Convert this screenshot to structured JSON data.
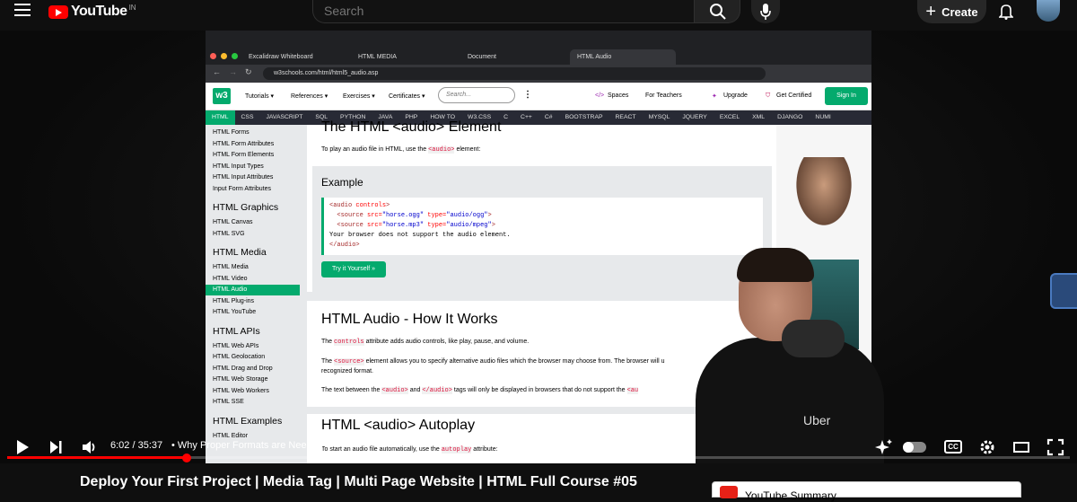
{
  "topbar": {
    "logo_text": "YouTube",
    "country_code": "IN",
    "search_placeholder": "Search",
    "create_label": "Create"
  },
  "browser": {
    "tabs": [
      "Excalidraw Whiteboard",
      "HTML MEDIA",
      "Document",
      "HTML Audio"
    ],
    "url": "w3schools.com/html/html5_audio.asp"
  },
  "w3": {
    "logo": "w3",
    "menus": [
      "Tutorials ▾",
      "References ▾",
      "Exercises ▾",
      "Certificates ▾"
    ],
    "search_placeholder": "Search...",
    "spaces": "Spaces",
    "teachers": "For Teachers",
    "upgrade": "Upgrade",
    "certified": "Get Certified",
    "signin": "Sign In",
    "topics": [
      "HTML",
      "CSS",
      "JAVASCRIPT",
      "SQL",
      "PYTHON",
      "JAVA",
      "PHP",
      "HOW TO",
      "W3.CSS",
      "C",
      "C++",
      "C#",
      "BOOTSTRAP",
      "REACT",
      "MYSQL",
      "JQUERY",
      "EXCEL",
      "XML",
      "DJANGO",
      "NUMI"
    ],
    "sidebar": {
      "group1": [
        "HTML Forms",
        "HTML Form Attributes",
        "HTML Form Elements",
        "HTML Input Types",
        "HTML Input Attributes",
        "Input Form Attributes"
      ],
      "h_graphics": "HTML Graphics",
      "group2": [
        "HTML Canvas",
        "HTML SVG"
      ],
      "h_media": "HTML Media",
      "group3": [
        "HTML Media",
        "HTML Video",
        "HTML Audio",
        "HTML Plug-ins",
        "HTML YouTube"
      ],
      "h_apis": "HTML APIs",
      "group4": [
        "HTML Web APIs",
        "HTML Geolocation",
        "HTML Drag and Drop",
        "HTML Web Storage",
        "HTML Web Workers",
        "HTML SSE"
      ],
      "h_examples": "HTML Examples",
      "group5": [
        "HTML Editor"
      ]
    },
    "page_heading": "The HTML <audio> Element",
    "intro_a": "To play an audio file in HTML, use the",
    "intro_kw": "<audio>",
    "intro_b": "element:",
    "example_title": "Example",
    "code": [
      "<audio controls>",
      "  <source src=\"horse.ogg\" type=\"audio/ogg\">",
      "  <source src=\"horse.mp3\" type=\"audio/mpeg\">",
      "Your browser does not support the audio element.",
      "</audio>"
    ],
    "tryit": "Try it Yourself »",
    "h_how": "HTML Audio - How It Works",
    "p1_a": "The",
    "p1_kw": "controls",
    "p1_b": "attribute adds audio controls, like play, pause, and volume.",
    "p2_a": "The",
    "p2_kw": "<source>",
    "p2_b": "element allows you to specify alternative audio files which the browser may choose from. The browser will u",
    "p2_c": "recognized format.",
    "p3_a": "The text between the",
    "p3_kw1": "<audio>",
    "p3_and": "and",
    "p3_kw2": "</audio>",
    "p3_b": "tags will only be displayed in browsers that do not support the",
    "p3_kw3": "<au",
    "h_autoplay": "HTML <audio> Autoplay",
    "p4_a": "To start an audio file automatically, use the",
    "p4_kw": "autoplay",
    "p4_b": "attribute:"
  },
  "presenter": {
    "shirt_text": "Uber"
  },
  "player": {
    "time": "6:02 / 35:37",
    "chapter": "•  Why Proper Formats are Needed",
    "chapter_arrow": "›",
    "progress": 0.169
  },
  "video_title": "Deploy Your First Project | Media Tag | Multi Page Website | HTML Full Course #05",
  "summary_label": "YouTube Summary",
  "colors": {
    "accent": "#ff0000",
    "w3green": "#04aa6d"
  }
}
